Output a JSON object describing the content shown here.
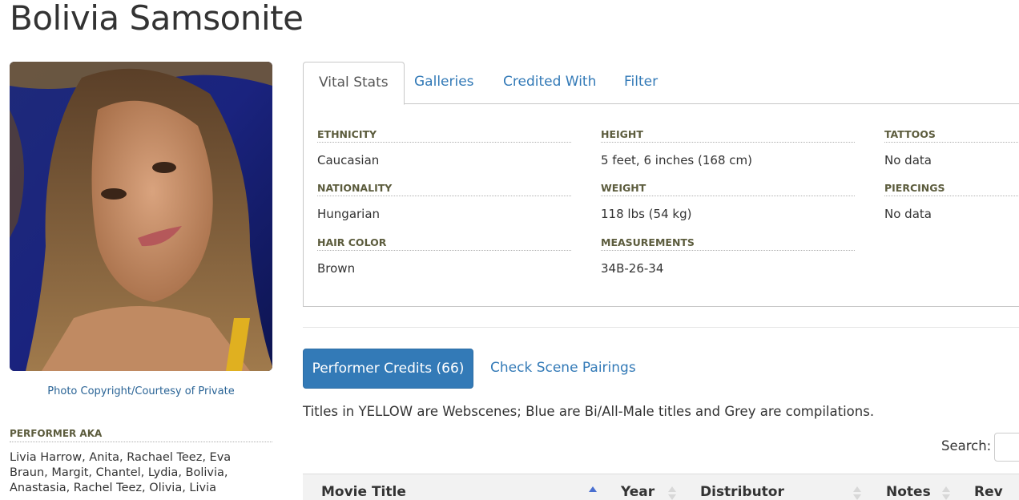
{
  "performer": {
    "name": "Bolivia Samsonite",
    "photo_credit": "Photo Copyright/Courtesy of Private",
    "aka_heading": "PERFORMER AKA",
    "aka": "Livia Harrow, Anita, Rachael Teez, Eva Braun, Margit, Chantel, Lydia, Bolivia, Anastasia, Rachel Teez, Olivia, Livia"
  },
  "tabs": [
    {
      "label": "Vital Stats",
      "active": true
    },
    {
      "label": "Galleries",
      "active": false
    },
    {
      "label": "Credited With",
      "active": false
    },
    {
      "label": "Filter",
      "active": false
    }
  ],
  "stats": {
    "ethnicity": {
      "label": "ETHNICITY",
      "value": "Caucasian"
    },
    "nationality": {
      "label": "NATIONALITY",
      "value": "Hungarian"
    },
    "hair_color": {
      "label": "HAIR COLOR",
      "value": "Brown"
    },
    "height": {
      "label": "HEIGHT",
      "value": "5 feet, 6 inches (168 cm)"
    },
    "weight": {
      "label": "WEIGHT",
      "value": "118 lbs (54 kg)"
    },
    "measurements": {
      "label": "MEASUREMENTS",
      "value": "34B-26-34"
    },
    "tattoos": {
      "label": "TATTOOS",
      "value": "No data"
    },
    "piercings": {
      "label": "PIERCINGS",
      "value": "No data"
    }
  },
  "credits": {
    "button_label": "Performer Credits (66)",
    "pairings_label": "Check Scene Pairings",
    "legend": "Titles in YELLOW are Webscenes; Blue are Bi/All-Male titles and Grey are compilations.",
    "search_label": "Search:",
    "search_value": ""
  },
  "table": {
    "columns": [
      "Movie Title",
      "Year",
      "Distributor",
      "Notes",
      "Rev"
    ]
  },
  "colors": {
    "link": "#337ab7",
    "button": "#337ab7",
    "label": "#5c5c3d",
    "text": "#333333",
    "sort_active": "#4a6fd0"
  }
}
